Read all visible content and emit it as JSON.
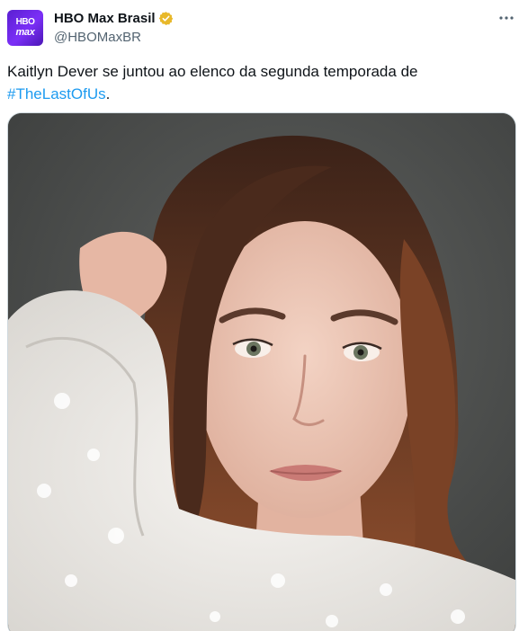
{
  "author": {
    "display_name": "HBO Max Brasil",
    "handle": "@HBOMaxBR",
    "avatar_text_line1": "HBO",
    "avatar_text_line2": "max",
    "verified_color": "#e8b829"
  },
  "tweet": {
    "text_main": "Kaitlyn Dever se juntou ao elenco da segunda temporada de",
    "hashtag": "#TheLastOfUs",
    "text_end": "."
  },
  "media": {
    "description_icon": "photo-portrait"
  },
  "icons": {
    "more": "more-options-icon",
    "verified": "verified-badge-icon"
  },
  "colors": {
    "link": "#1d9bf0",
    "secondary_text": "#536471",
    "avatar_bg": "#6a24e6"
  }
}
